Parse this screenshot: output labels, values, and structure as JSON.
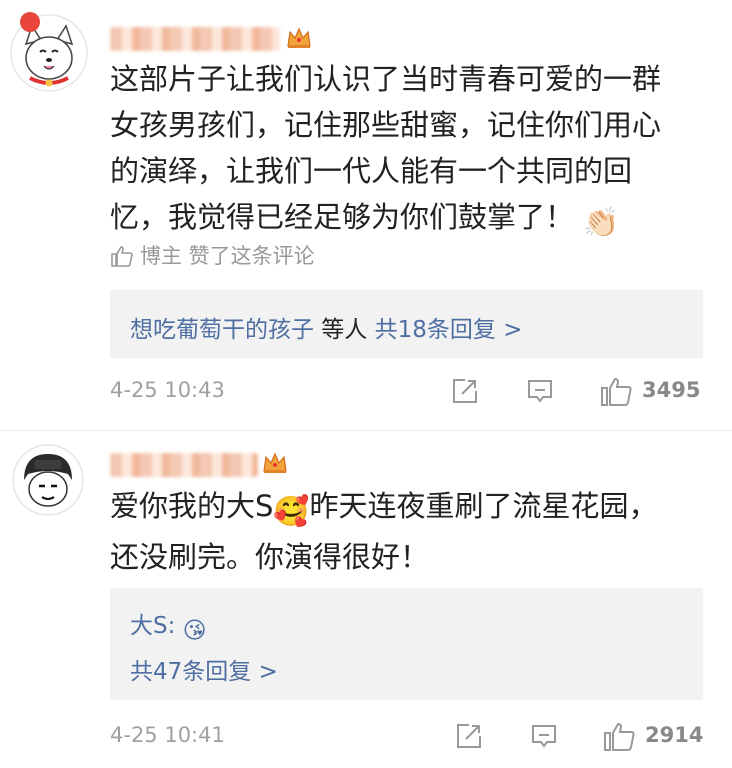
{
  "comments": [
    {
      "text": "这部片子让我们认识了当时青春可爱的一群\n女孩男孩们，记住那些甜蜜，记住你们用心\n的演绎，让我们一代人能有一个共同的回\n忆，我觉得已经足够为你们鼓掌了！",
      "text_emoji": "👏🏻",
      "author_liked": "博主 赞了这条评论",
      "replies": {
        "summary_prefix": "想吃葡萄干的孩子",
        "summary_mid": " 等人 ",
        "summary_count": "共18条回复 >"
      },
      "timestamp": "4-25 10:43",
      "like_count": "3495"
    },
    {
      "text_a": "爱你我的大S",
      "text_emoji_a": "🥰",
      "text_b": "昨天连夜重刷了流星花园，\n还没刷完。你演得很好！",
      "replies": {
        "reply_author": "大S:",
        "reply_emoji": "😘",
        "summary_count": "共47条回复 >"
      },
      "timestamp": "4-25 10:41",
      "like_count": "2914"
    }
  ],
  "icons": {
    "share": "share-icon",
    "comment": "comment-icon",
    "like": "thumbs-up-icon",
    "crown": "crown-badge-icon"
  },
  "colors": {
    "link": "#4f6fa3",
    "meta": "#a0a0a0",
    "reply_bg": "#f2f2f2"
  }
}
